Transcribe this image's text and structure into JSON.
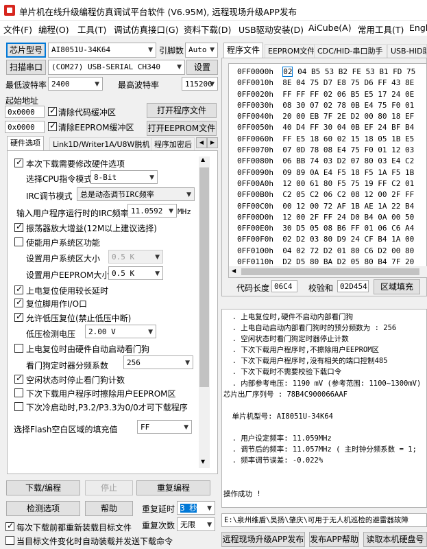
{
  "window": {
    "title": "单片机在线升级编程仿真调试平台软件 (V6.95M), 远程现场升级APP发布"
  },
  "menu": [
    "文件(F)",
    "编程(O)",
    "工具(T)",
    "调试仿真接口(G)",
    "资料下载(D)",
    "USB驱动安装(D)",
    "AiCube(A)",
    "常用工具(T)",
    "Engl"
  ],
  "left": {
    "chip_label": "芯片型号",
    "chip_value": "AI8051U-34K64",
    "pin_label": "引脚数",
    "pin_value": "Auto",
    "scan_label": "扫描串口",
    "port_value": "(COM27) USB-SERIAL CH340",
    "settings_label": "设置",
    "min_baud_label": "最低波特率",
    "min_baud_value": "2400",
    "max_baud_label": "最高波特率",
    "max_baud_value": "115200",
    "start_addr_label": "起始地址",
    "code_addr": "0x0000",
    "clear_code_label": "清除代码缓冲区",
    "open_prog_label": "打开程序文件",
    "eeprom_addr": "0x0000",
    "clear_eeprom_label": "清除EEPROM缓冲区",
    "open_eeprom_label": "打开EEPROM文件",
    "tabs": [
      "硬件选项",
      "Link1D/Writer1A/U8W脱机",
      "程序加密后"
    ],
    "options": {
      "modify_hw": "本次下载需要修改硬件选项",
      "cpu_mode_label": "选择CPU指令模式",
      "cpu_mode_value": "8-Bit",
      "irc_mode_label": "IRC调节模式",
      "irc_mode_value": "总是动态调节IRC频率",
      "irc_freq_label": "输入用户程序运行时的IRC频率",
      "irc_freq_value": "11.0592",
      "irc_freq_unit": "MHz",
      "osc_gain": "振荡器放大增益(12M以上建议选择)",
      "user_sys": "使能用户系统区功能",
      "user_sys_size_label": "设置用户系统区大小",
      "user_sys_size_value": "0.5 K",
      "user_eeprom_label": "设置用户EEPROM大小",
      "user_eeprom_value": "0.5 K",
      "long_reset": "上电复位使用较长延时",
      "reset_io": "复位脚用作I/O口",
      "lvr": "允许低压复位(禁止低压中断)",
      "lvd_label": "低压检测电压",
      "lvd_value": "2.00 V",
      "auto_wdt": "上电复位时由硬件自动启动看门狗",
      "wdt_div_label": "看门狗定时器分频系数",
      "wdt_div_value": "256",
      "idle_wdt": "空闲状态时停止看门狗计数",
      "erase_eeprom": "下次下载用户程序时擦除用户EEPROM区",
      "p32_p33": "下次冷启动时,P3.2/P3.3为0/0才可下载程序",
      "fill_label": "选择Flash空白区域的填充值",
      "fill_value": "FF"
    },
    "download_label": "下载/编程",
    "stop_label": "停止",
    "reprogram_label": "重复编程",
    "check_label": "检测选项",
    "help_label": "帮助",
    "repeat_delay_label": "重复延时",
    "repeat_delay_value": "3 秒",
    "reload_label": "每次下载前都重新装载目标文件",
    "repeat_count_label": "重复次数",
    "repeat_count_value": "无限",
    "auto_load_label": "当目标文件变化时自动装载并发送下载命令"
  },
  "right": {
    "tabs": [
      "程序文件",
      "EEPROM文件",
      "CDC/HID-串口助手",
      "USB-HID助"
    ],
    "hex_rows": [
      {
        "addr": "0FF0000h",
        "bytes": "02 04 B5 53 B2 FE 53 B1 FD 75"
      },
      {
        "addr": "0FF0010h",
        "bytes": "8E 04 75 D7 E8 75 D6 FF 43 8E"
      },
      {
        "addr": "0FF0020h",
        "bytes": "FF FF FF 02 06 B5 E5 17 24 0E"
      },
      {
        "addr": "0FF0030h",
        "bytes": "08 30 07 02 78 0B E4 75 F0 01"
      },
      {
        "addr": "0FF0040h",
        "bytes": "20 00 EB 7F 2E D2 00 80 18 EF"
      },
      {
        "addr": "0FF0050h",
        "bytes": "40 D4 FF 30 04 0B EF 24 BF B4"
      },
      {
        "addr": "0FF0060h",
        "bytes": "FF E5 18 60 02 15 18 05 1B E5"
      },
      {
        "addr": "0FF0070h",
        "bytes": "07 0D 78 08 E4 75 F0 01 12 03"
      },
      {
        "addr": "0FF0080h",
        "bytes": "06 BB 74 03 D2 07 80 03 E4 C2"
      },
      {
        "addr": "0FF0090h",
        "bytes": "09 89 0A E4 F5 18 F5 1A F5 1B"
      },
      {
        "addr": "0FF00A0h",
        "bytes": "12 00 61 80 F5 75 19 FF C2 01"
      },
      {
        "addr": "0FF00B0h",
        "bytes": "C2 05 C2 06 C2 08 12 00 2F FF"
      },
      {
        "addr": "0FF00C0h",
        "bytes": "00 12 00 72 AF 1B AE 1A 22 B4"
      },
      {
        "addr": "0FF00D0h",
        "bytes": "12 00 2F FF 24 D0 B4 0A 00 50"
      },
      {
        "addr": "0FF00E0h",
        "bytes": "30 D5 05 08 B6 FF 01 06 C6 A4"
      },
      {
        "addr": "0FF00F0h",
        "bytes": "02 D2 03 80 D9 24 CF B4 1A 00"
      },
      {
        "addr": "0FF0100h",
        "bytes": "04 02 72 D2 01 80 C6 D2 00 80"
      },
      {
        "addr": "0FF0110h",
        "bytes": "D2 D5 80 BA D2 05 80 B4 7F 20"
      },
      {
        "addr": "0FF0120h",
        "bytes": "74 01 B5 18 00 40 F1 12 00 26"
      }
    ],
    "code_len_label": "代码长度",
    "code_len_value": "06C4",
    "checksum_label": "校验和",
    "checksum_value": "02D454",
    "fill_area_label": "区域填充",
    "log": [
      "  . 上电复位时,硬件不启动内部看门狗",
      "  . 上电自动启动内部看门狗时的预分频数为 : 256",
      "  . 空闲状态时看门狗定时器停止计数",
      "  . 下次下载用户程序时,不擦除用户EEPROM区",
      "  . 下次下载用户程序时,没有相关的端口控制485",
      "  . 下次下载时不需要校验下载口令",
      "  . 内部参考电压: 1190 mV (参考范围: 1100~1300mV)",
      "芯片出厂序列号 : 78B4C900066AAF",
      "",
      "  单片机型号: AI8051U-34K64",
      "",
      "  . 用户设定频率: 11.059MHz",
      "  . 调节后的频率: 11.057MHz ( 主时钟分频系数 = 1;",
      "  . 频率调节误差: -0.022%",
      "",
      "",
      "操作成功 !"
    ],
    "path": "E:\\泉州维盾\\吴扬\\肇庆\\可用于无人机巡检的避雷器故障",
    "publish_label": "远程现场升级APP发布",
    "publish_help_label": "发布APP帮助",
    "read_disk_label": "读取本机硬盘号"
  }
}
